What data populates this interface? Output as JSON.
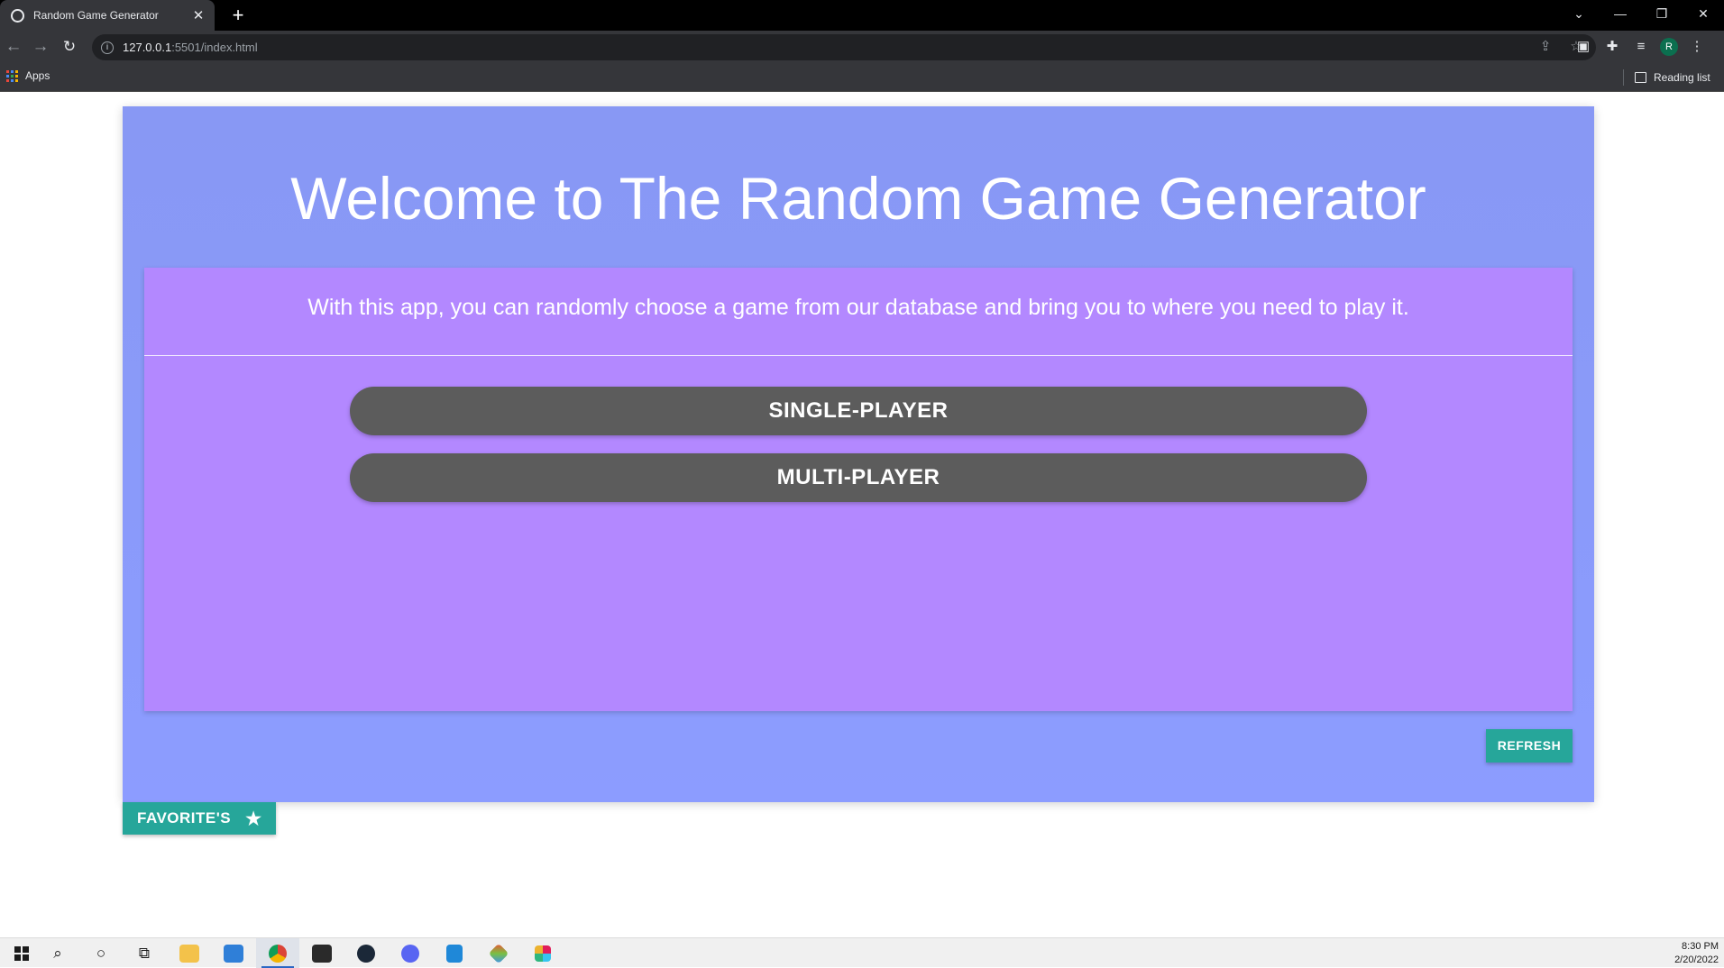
{
  "browser": {
    "tab_title": "Random Game Generator",
    "tab_close": "✕",
    "new_tab": "+",
    "url_host": "127.0.0.1",
    "url_rest": ":5501/index.html",
    "bookmarks": {
      "apps_label": "Apps",
      "reading_list_label": "Reading list"
    },
    "profile_initial": "R",
    "window_controls": {
      "tab_search": "⌄",
      "minimize": "—",
      "restore": "❐",
      "close": "✕"
    }
  },
  "page": {
    "title": "Welcome to The Random Game Generator",
    "description": "With this app, you can randomly choose a game from our database and bring you to where you need to play it.",
    "buttons": {
      "single_player": "SINGLE-PLAYER",
      "multi_player": "MULTI-PLAYER",
      "refresh": "REFRESH",
      "favorites": "FAVORITE'S"
    },
    "colors": {
      "card_background": "#8c9cff",
      "panel_background": "#b388ff",
      "mode_button": "#5c5c5c",
      "teal_button": "#26a69a"
    }
  },
  "taskbar": {
    "apps": [
      "windows-start",
      "search",
      "cortana",
      "task-view",
      "file-explorer",
      "mail",
      "chrome",
      "epic-games",
      "steam",
      "discord",
      "vscode",
      "git-kraken",
      "slack"
    ],
    "time": "8:30 PM",
    "date": "2/20/2022"
  }
}
